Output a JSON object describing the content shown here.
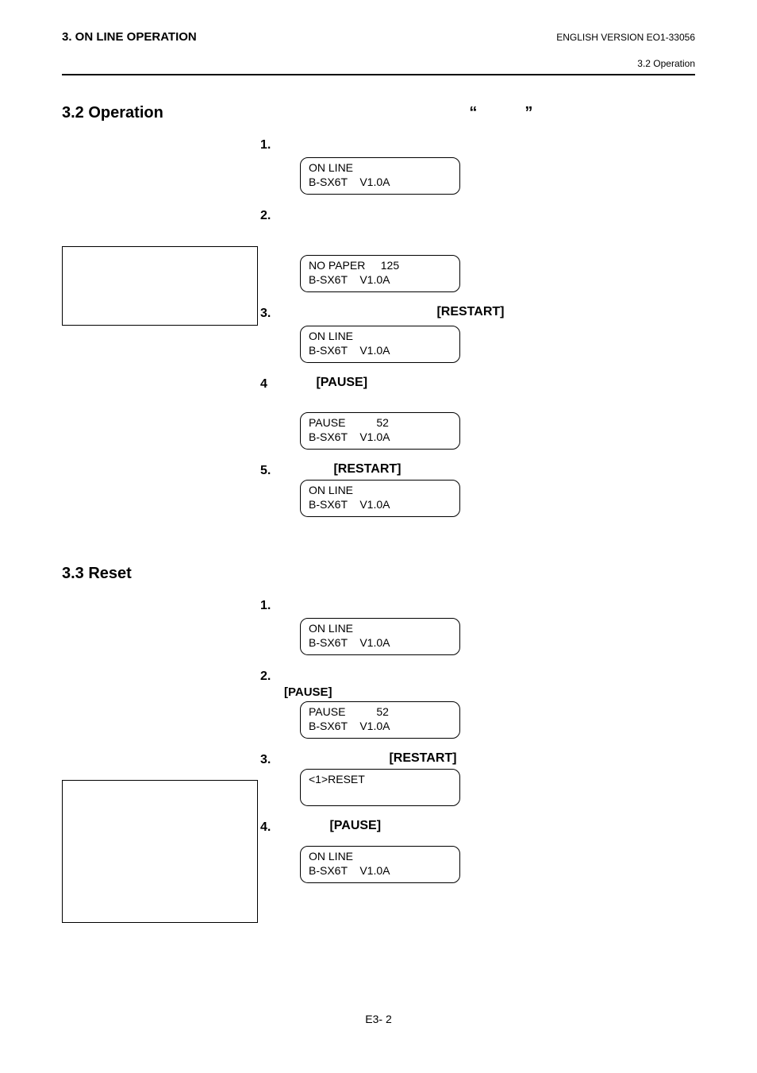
{
  "header": {
    "left": "3. ON LINE OPERATION",
    "right": "ENGLISH VERSION EO1-33056",
    "sub": "3.2 Operation"
  },
  "sections": {
    "s32": {
      "title": "3.2  Operation",
      "quoteLeft": "“",
      "quoteRight": "”",
      "steps": {
        "n1": "1.",
        "n2": "2.",
        "n3": "3.",
        "n4": "4",
        "n5": "5.",
        "restart3": "[RESTART]",
        "pause4": "[PAUSE]",
        "restart5": "[RESTART]"
      },
      "lcd": {
        "l1r1": "ON LINE",
        "l1r2": "B-SX6T    V1.0A",
        "l2r1": "NO PAPER     125",
        "l2r2": "B-SX6T    V1.0A",
        "l3r1": "ON LINE",
        "l3r2": "B-SX6T    V1.0A",
        "l4r1": "PAUSE          52",
        "l4r2": "B-SX6T    V1.0A",
        "l5r1": "ON LINE",
        "l5r2": "B-SX6T    V1.0A"
      }
    },
    "s33": {
      "title": "3.3  Reset",
      "steps": {
        "n1": "1.",
        "n2": "2.",
        "n3": "3.",
        "n4": "4.",
        "pause2": "[PAUSE]",
        "restart3": "[RESTART]",
        "pause4": "[PAUSE]"
      },
      "lcd": {
        "l1r1": "ON LINE",
        "l1r2": "B-SX6T    V1.0A",
        "l2r1": "PAUSE          52",
        "l2r2": "B-SX6T    V1.0A",
        "l3r1": "<1>RESET",
        "l3r2": " ",
        "l4r1": "ON LINE",
        "l4r2": "B-SX6T    V1.0A"
      }
    }
  },
  "footer": "E3- 2"
}
